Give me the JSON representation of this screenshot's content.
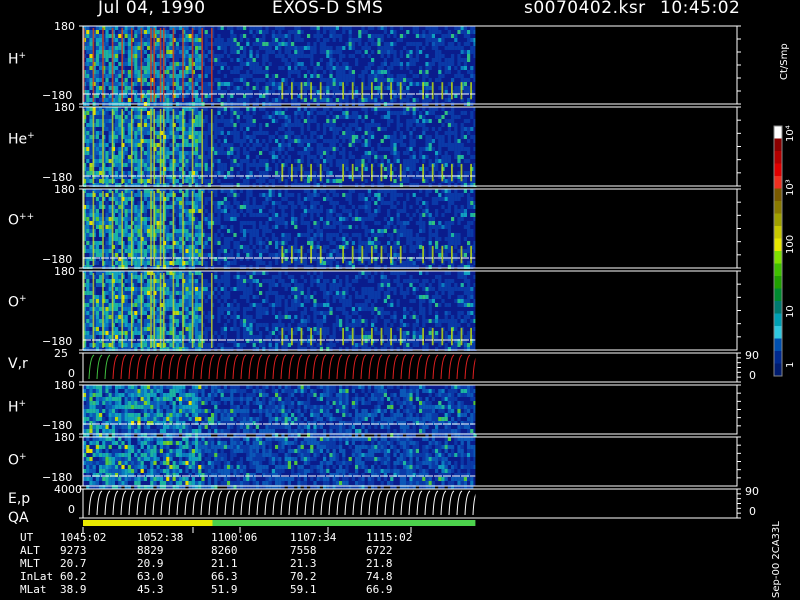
{
  "header": {
    "date": "Jul 04, 1990",
    "instrument": "EXOS-D SMS",
    "file": "s0070402.ksr",
    "time": "10:45:02"
  },
  "colors": {
    "background": "#000000",
    "spectrogram_bg": "#0a1c8c",
    "blank_region": "#000000",
    "grid_line": "#ffffff",
    "qa_bar_yellow": "#e8e800",
    "qa_bar_green": "#4cd24c"
  },
  "chart_data": {
    "type": "heatmap",
    "panels": [
      {
        "name": "H",
        "charge": "+",
        "ylim": [
          -180,
          180
        ],
        "ytick_labels": [
          "180",
          "−180"
        ]
      },
      {
        "name": "He",
        "charge": "+",
        "ylim": [
          -180,
          180
        ],
        "ytick_labels": [
          "180",
          "−180"
        ]
      },
      {
        "name": "O",
        "charge": "++",
        "ylim": [
          -180,
          180
        ],
        "ytick_labels": [
          "180",
          "−180"
        ]
      },
      {
        "name": "O",
        "charge": "+",
        "ylim": [
          -180,
          180
        ],
        "ytick_labels": [
          "180",
          "−180"
        ]
      },
      {
        "name": "V,r",
        "charge": "",
        "ylim": [
          0,
          25
        ],
        "ytick_labels": [
          "25",
          "0"
        ],
        "right_ticks": [
          "90",
          "0"
        ]
      },
      {
        "name": "H",
        "charge": "+",
        "ylim": [
          -180,
          180
        ],
        "ytick_labels": [
          "180",
          "−180"
        ]
      },
      {
        "name": "O",
        "charge": "+",
        "ylim": [
          -180,
          180
        ],
        "ytick_labels": [
          "180",
          "−180"
        ]
      },
      {
        "name": "E,p",
        "charge": "",
        "ylim": [
          0,
          4000
        ],
        "ytick_labels": [
          "4000",
          "0"
        ],
        "right_ticks": [
          "90",
          "0"
        ]
      }
    ],
    "qa_label": "QA",
    "colorbar": {
      "unit": "Ct/Smp",
      "scale": "log",
      "tick_labels": [
        "10⁴",
        "10³",
        "100",
        "10",
        "1"
      ],
      "colors": [
        "#ffffff",
        "#8a0000",
        "#b40000",
        "#e00000",
        "#f03020",
        "#7a5a00",
        "#8a7a00",
        "#a0a000",
        "#c8c800",
        "#e8e800",
        "#80e000",
        "#40c000",
        "#20a000",
        "#008a30",
        "#007a70",
        "#00a0b4",
        "#30c8e0",
        "#0050b0",
        "#002a90",
        "#001c70"
      ]
    },
    "time_axis": {
      "row_labels": [
        "UT",
        "ALT",
        "MLT",
        "InLat",
        "MLat"
      ],
      "columns": [
        {
          "UT": "1045:02",
          "ALT": "9273",
          "MLT": "20.7",
          "InLat": "60.2",
          "MLat": "38.9"
        },
        {
          "UT": "1052:38",
          "ALT": "8829",
          "MLT": "20.9",
          "InLat": "63.0",
          "MLat": "45.3"
        },
        {
          "UT": "1100:06",
          "ALT": "8260",
          "MLT": "21.1",
          "InLat": "66.3",
          "MLat": "51.9"
        },
        {
          "UT": "1107:34",
          "ALT": "7558",
          "MLT": "21.3",
          "InLat": "70.2",
          "MLat": "59.1"
        },
        {
          "UT": "1115:02",
          "ALT": "6722",
          "MLT": "21.8",
          "InLat": "74.8",
          "MLat": "66.9"
        }
      ]
    },
    "data_end_fraction": 0.6
  },
  "footer": {
    "version_stamp": "Sep-00 2CA33L"
  }
}
